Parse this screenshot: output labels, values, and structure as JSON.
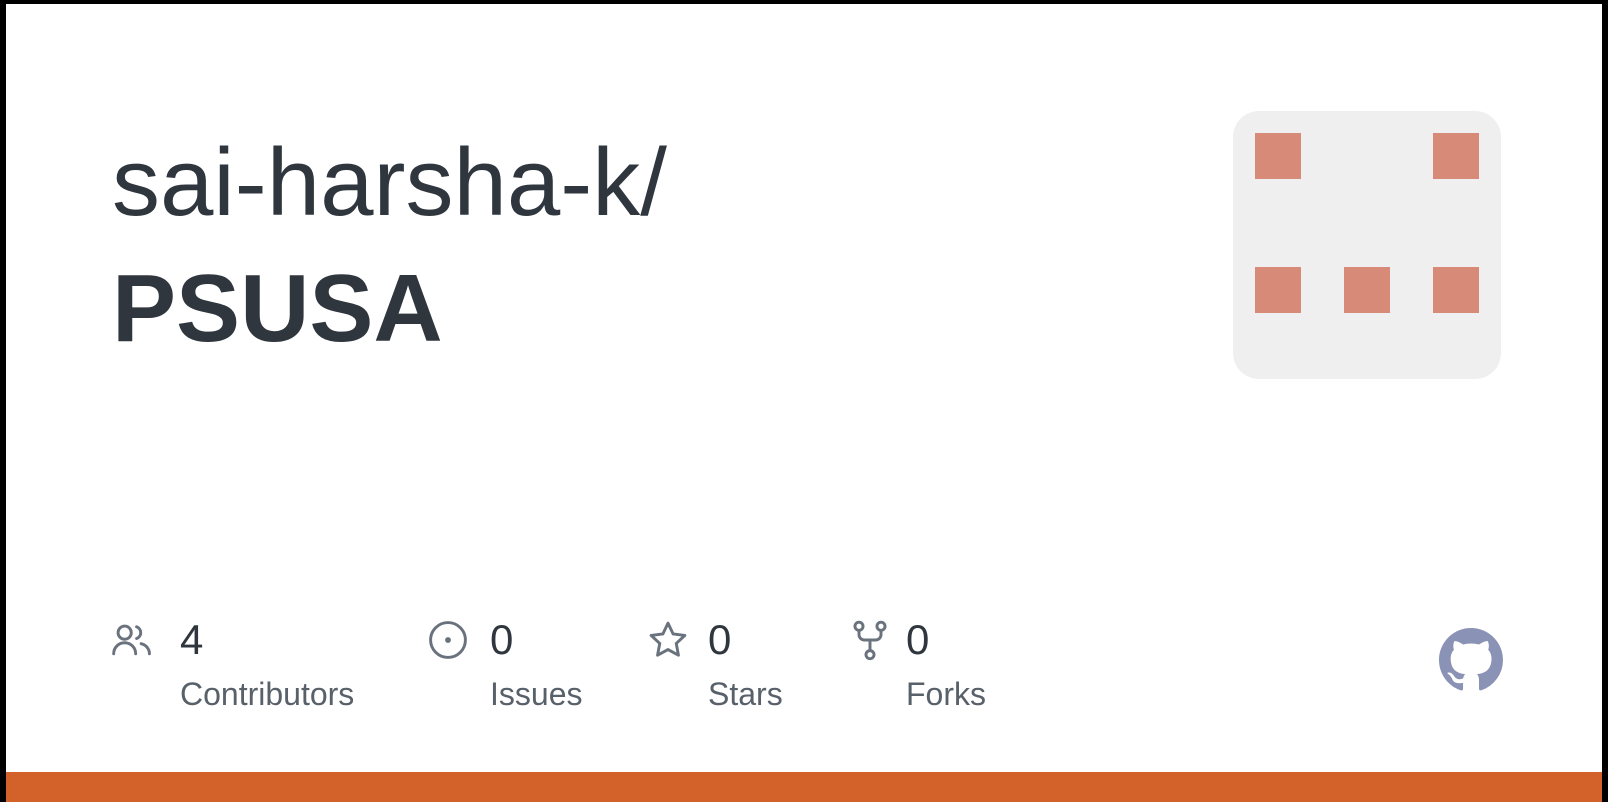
{
  "repo": {
    "owner": "sai-harsha-k/",
    "name": "PSUSA"
  },
  "avatar": {
    "background": "#efefef",
    "pixel_color": "#d88a79"
  },
  "stats": [
    {
      "icon": "contributors-icon",
      "value": "4",
      "label": "Contributors"
    },
    {
      "icon": "issues-icon",
      "value": "0",
      "label": "Issues"
    },
    {
      "icon": "star-icon",
      "value": "0",
      "label": "Stars"
    },
    {
      "icon": "fork-icon",
      "value": "0",
      "label": "Forks"
    }
  ],
  "colors": {
    "text": "#2f363d",
    "muted": "#586069",
    "icon": "#6a737d",
    "github_mark": "#8a93b5",
    "bottom_bar": "#d2622a"
  }
}
